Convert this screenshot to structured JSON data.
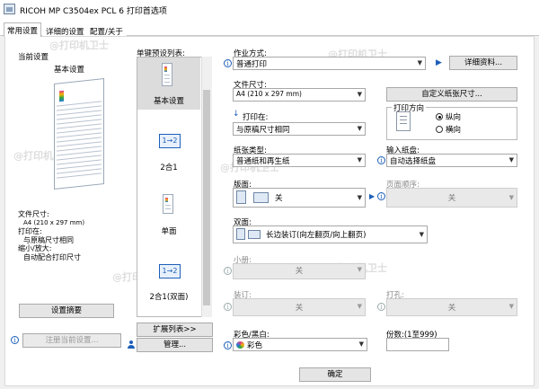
{
  "window": {
    "title": "RICOH MP C3504ex PCL 6 打印首选项"
  },
  "tabs": [
    {
      "label": "常用设置",
      "active": true
    },
    {
      "label": "详细的设置",
      "active": false
    },
    {
      "label": "配置/关于",
      "active": false
    }
  ],
  "left": {
    "current_title": "当前设置",
    "current_name": "基本设置",
    "summary_lines": [
      "文件尺寸:",
      "A4 (210 x 297 mm)",
      "打印在:",
      "与原稿尺寸相同",
      "缩小/放大:",
      "自动配合打印尺寸"
    ],
    "summary_button": "设置摘要",
    "register_button": "注册当前设置..."
  },
  "presets": {
    "title": "单键预设列表:",
    "items": [
      {
        "label": "基本设置",
        "icon": "document-icon"
      },
      {
        "label": "2合1",
        "icon": "two-in-one-icon"
      },
      {
        "label": "单面",
        "icon": "single-sided-icon"
      },
      {
        "label": "2合1(双面)",
        "icon": "two-in-one-duplex-icon"
      }
    ],
    "expand_button": "扩展列表>>",
    "manage_button": "管理..."
  },
  "form": {
    "job_type_label": "作业方式:",
    "job_type_value": "普通打印",
    "details_button": "详细资料...",
    "paper_size_label": "文件尺寸:",
    "paper_size_value": "A4 (210 x 297 mm)",
    "custom_size_button": "自定义纸张尺寸...",
    "print_on_label": "打印在:",
    "print_on_value": "与原稿尺寸相同",
    "orientation_label": "打印方向",
    "orientation_portrait": "纵向",
    "orientation_landscape": "横向",
    "paper_type_label": "纸张类型:",
    "paper_type_value": "普通纸和再生纸",
    "input_tray_label": "输入纸盘:",
    "input_tray_value": "自动选择纸盘",
    "layout_label": "版面:",
    "layout_value": "关",
    "page_order_label": "页面顺序:",
    "page_order_value": "关",
    "duplex_label": "双面:",
    "duplex_value": "长边装订(向左翻页/向上翻页)",
    "booklet_label": "小册:",
    "booklet_value": "关",
    "staple_label": "装订:",
    "staple_value": "关",
    "punch_label": "打孔:",
    "punch_value": "关",
    "color_label": "彩色/黑白:",
    "color_value": "彩色",
    "copies_label": "份数:(1至999)"
  },
  "footer": {
    "ok_button": "确定"
  },
  "watermark_text": "@打印机卫士"
}
